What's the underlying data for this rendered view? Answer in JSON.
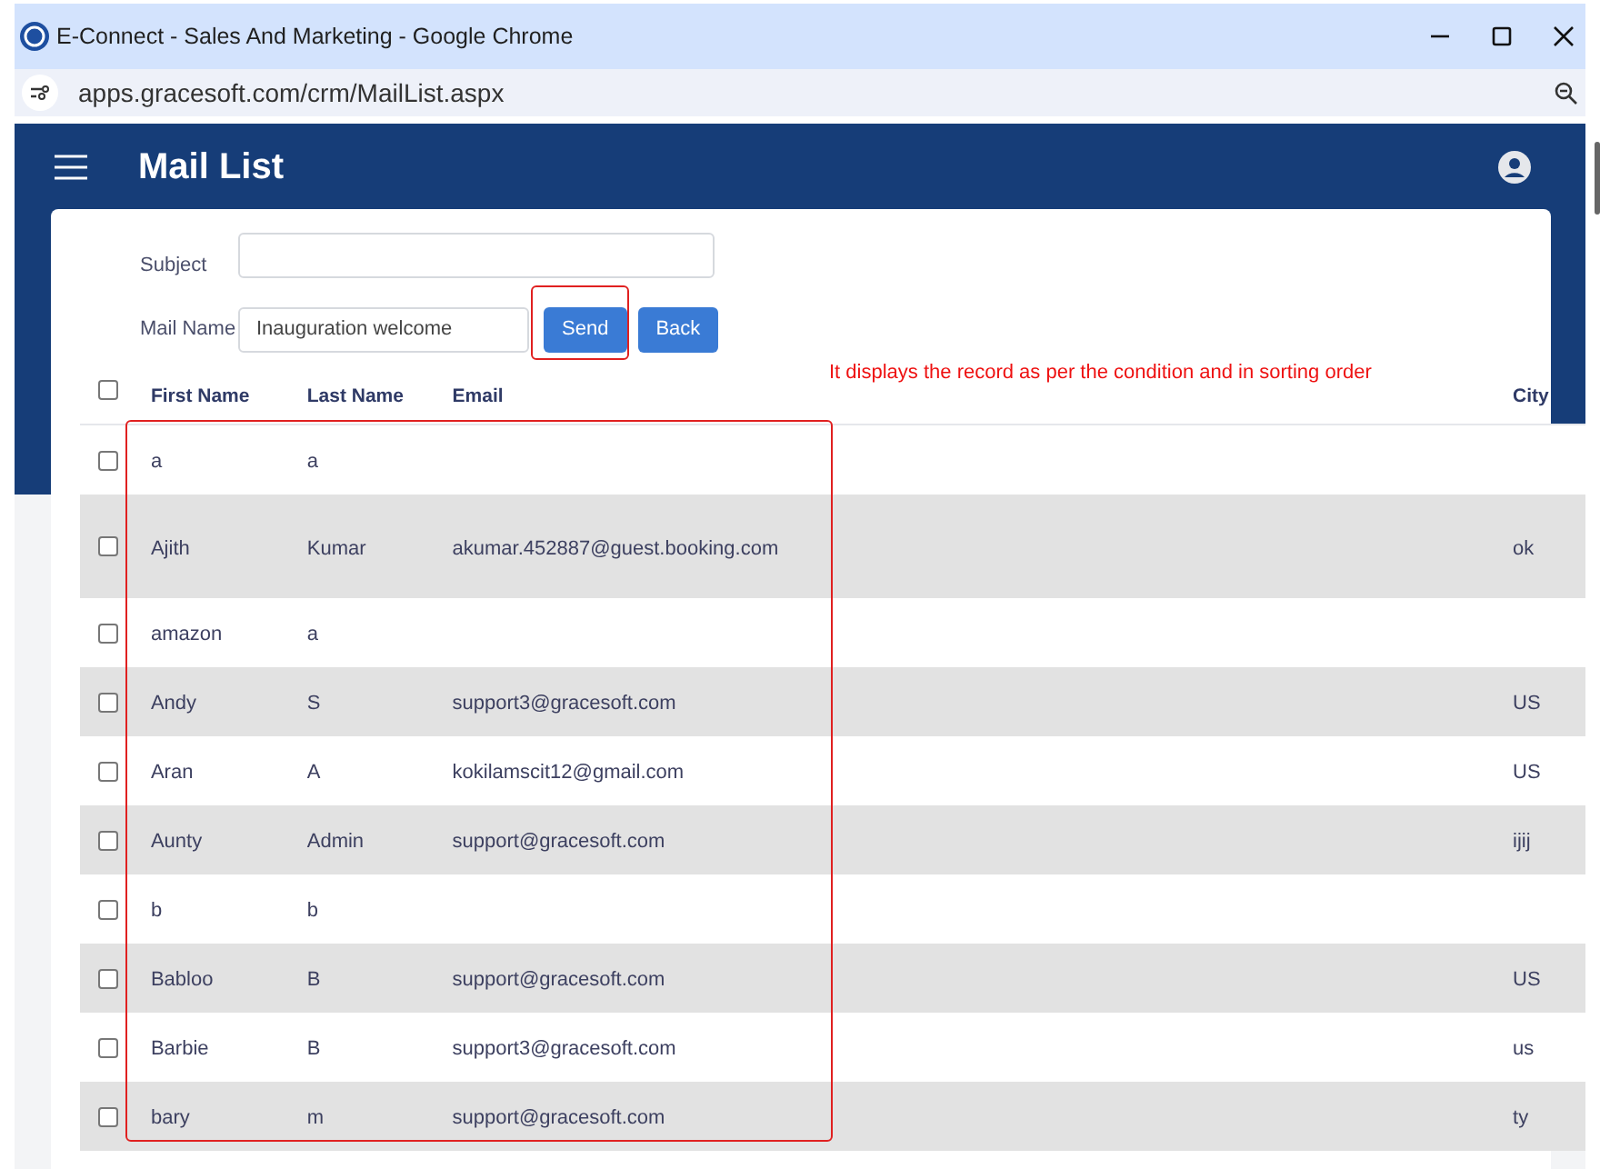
{
  "window": {
    "title": "E-Connect - Sales And Marketing - Google Chrome"
  },
  "address_bar": {
    "url": "apps.gracesoft.com/crm/MailList.aspx"
  },
  "header": {
    "title": "Mail List"
  },
  "form": {
    "subject": {
      "label": "Subject"
    },
    "mail_name": {
      "label": "Mail Name",
      "value": "Inauguration welcome"
    },
    "buttons": [
      "Send",
      "Back"
    ]
  },
  "annotation": "It displays the record as per the condition and in sorting order",
  "table": {
    "select_all": {
      "checked": false
    },
    "columns": [
      "First Name",
      "Last Name",
      "Email",
      "City"
    ],
    "rows": [
      {
        "checked": false,
        "cells": [
          "a",
          "a",
          "",
          ""
        ]
      },
      {
        "checked": false,
        "cells": [
          "Ajith",
          "Kumar",
          "akumar.452887@guest.booking.com",
          "ok"
        ]
      },
      {
        "checked": false,
        "cells": [
          "amazon",
          "a",
          "",
          ""
        ]
      },
      {
        "checked": false,
        "cells": [
          "Andy",
          "S",
          "support3@gracesoft.com",
          "US"
        ]
      },
      {
        "checked": false,
        "cells": [
          "Aran",
          "A",
          "kokilamscit12@gmail.com",
          "US"
        ]
      },
      {
        "checked": false,
        "cells": [
          "Aunty",
          "Admin",
          "support@gracesoft.com",
          "ijij"
        ]
      },
      {
        "checked": false,
        "cells": [
          "b",
          "b",
          "",
          ""
        ]
      },
      {
        "checked": false,
        "cells": [
          "Babloo",
          "B",
          "support@gracesoft.com",
          "US"
        ]
      },
      {
        "checked": false,
        "cells": [
          "Barbie",
          "B",
          "support3@gracesoft.com",
          "us"
        ]
      },
      {
        "checked": false,
        "cells": [
          "bary",
          "m",
          "support@gracesoft.com",
          "ty"
        ]
      }
    ]
  }
}
